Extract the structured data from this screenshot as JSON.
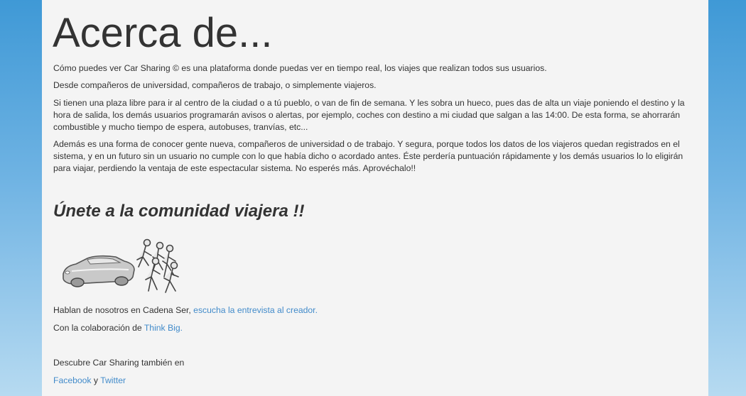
{
  "page": {
    "title": "Acerca de...",
    "paragraphs": [
      "Cómo puedes ver Car Sharing © es una plataforma donde puedas ver en tiempo real, los viajes que realizan todos sus usuarios.",
      "Desde compañeros de universidad, compañeros de trabajo, o simplemente viajeros.",
      "Si tienen una plaza libre para ir al centro de la ciudad o a tú pueblo, o van de fin de semana. Y les sobra un hueco, pues das de alta un viaje poniendo el destino y la hora de salida, los demás usuarios programarán avisos o alertas, por ejemplo, coches con destino a mi ciudad que salgan a las 14:00. De esta forma, se ahorrarán combustible y mucho tiempo de espera, autobuses, tranvías, etc...",
      "Además es una forma de conocer gente nueva, compañeros de universidad o de trabajo. Y segura, porque todos los datos de los viajeros quedan registrados en el sistema, y en un futuro sin un usuario no cumple con lo que había dicho o acordado antes. Éste perdería puntuación rápidamente y los demás usuarios lo lo eligirán para viajar, perdiendo la ventaja de este espectacular sistema. No esperés más. Aprovéchalo!!"
    ],
    "subtitle": "Únete a la comunidad viajera !!",
    "radio": {
      "text": "Hablan de nosotros en Cadena Ser, ",
      "link": "escucha la entrevista al creador."
    },
    "collab": {
      "text": "Con la colaboración de ",
      "link": "Think Big."
    },
    "discover": "Descubre Car Sharing también en",
    "social": {
      "facebook": "Facebook",
      "separator": " y ",
      "twitter": "Twitter"
    }
  },
  "colors": {
    "background_top": "#3f99d6",
    "background_bottom": "#b6daf1",
    "panel": "#f4f4f4",
    "text": "#333333",
    "link": "#428bca"
  },
  "icons": [
    "car-icon",
    "people-walking-icon"
  ]
}
